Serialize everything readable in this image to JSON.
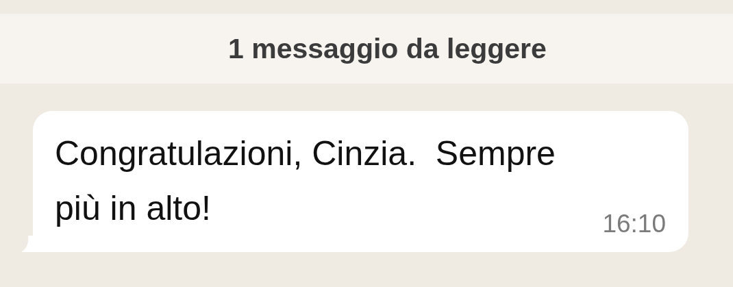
{
  "unread_banner": {
    "text": "1 messaggio da leggere"
  },
  "messages": [
    {
      "text": "Congratulazioni, Cinzia.  Sempre più in alto!",
      "time": "16:10",
      "kind": "incoming"
    }
  ]
}
